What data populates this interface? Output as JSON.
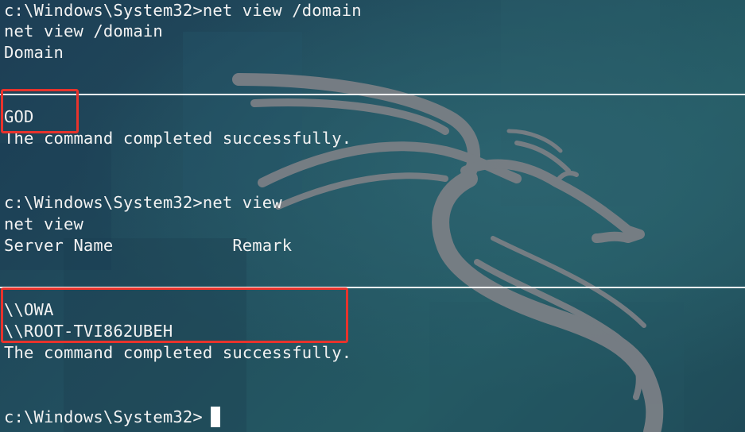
{
  "terminal": {
    "lines": [
      "c:\\Windows\\System32>net view /domain",
      "net view /domain",
      "Domain",
      "GOD",
      "The command completed successfully.",
      "c:\\Windows\\System32>net view",
      "net view",
      "Server Name            Remark",
      "\\\\OWA",
      "\\\\ROOT-TVI862UBEH",
      "The command completed successfully.",
      "c:\\Windows\\System32>"
    ]
  },
  "colors": {
    "text": "#f2f2f2",
    "background": "#1f4455",
    "highlight": "#e8332c",
    "logo": "#7a7f85"
  },
  "icons": {
    "background_logo": "kali-dragon-icon"
  }
}
